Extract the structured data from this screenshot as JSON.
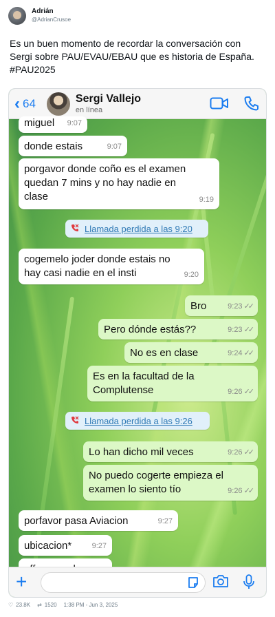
{
  "tweet": {
    "author": "Adrián",
    "handle": "@AdrianCrusoe",
    "text_lines": [
      "Es un buen momento de recordar la conversación con",
      "Sergi sobre PAU/EVAU/EBAU que es historia de España.",
      "#PAU2025"
    ],
    "likes": "23.8K",
    "retweets": "1520",
    "time": "1:38 PM - Jun 3, 2025"
  },
  "chat": {
    "back_count": "64",
    "contact_name": "Sergi Vallejo",
    "contact_status": "en línea",
    "messages": [
      {
        "dir": "in",
        "lines": [
          "miguel"
        ],
        "time": "9:07"
      },
      {
        "dir": "in",
        "lines": [
          "donde estais"
        ],
        "time": "9:07"
      },
      {
        "dir": "in",
        "lines": [
          "porgavor donde coño es el examen",
          "quedan 7 mins y no hay nadie en",
          "clase"
        ],
        "time": "9:19"
      },
      {
        "dir": "sys",
        "label": "Llamada perdida a las 9:20"
      },
      {
        "dir": "in",
        "lines": [
          "cogemelo joder donde estais no",
          "hay casi nadie en el insti"
        ],
        "time": "9:20"
      },
      {
        "dir": "out",
        "lines": [
          "Bro"
        ],
        "time": "9:23"
      },
      {
        "dir": "out",
        "lines": [
          "Pero dónde estás??"
        ],
        "time": "9:23"
      },
      {
        "dir": "out",
        "lines": [
          "No es en clase"
        ],
        "time": "9:24"
      },
      {
        "dir": "out",
        "lines": [
          "Es en la facultad de la",
          "Complutense"
        ],
        "time": "9:26"
      },
      {
        "dir": "sys",
        "label": "Llamada perdida a las 9:26"
      },
      {
        "dir": "out",
        "lines": [
          "Lo han dicho mil veces"
        ],
        "time": "9:26"
      },
      {
        "dir": "out",
        "lines": [
          "No puedo cogerte empieza el",
          "examen lo siento tío"
        ],
        "time": "9:26"
      },
      {
        "dir": "in",
        "lines": [
          "porfavor pasa Aviacion"
        ],
        "time": "9:27"
      },
      {
        "dir": "in",
        "lines": [
          "ubicacion*"
        ],
        "time": "9:27"
      },
      {
        "dir": "in",
        "lines": [
          "pff no puede ser"
        ],
        "time": ""
      }
    ]
  },
  "colors": {
    "accent_blue": "#1a7cf0",
    "outgoing_bubble": "#dcf8c6",
    "incoming_bubble": "#ffffff",
    "missed_call_red": "#e0393e"
  },
  "icons": [
    "video-call-icon",
    "phone-icon",
    "plus-icon",
    "sticker-icon",
    "camera-icon",
    "microphone-icon",
    "heart-icon",
    "retweet-icon"
  ]
}
